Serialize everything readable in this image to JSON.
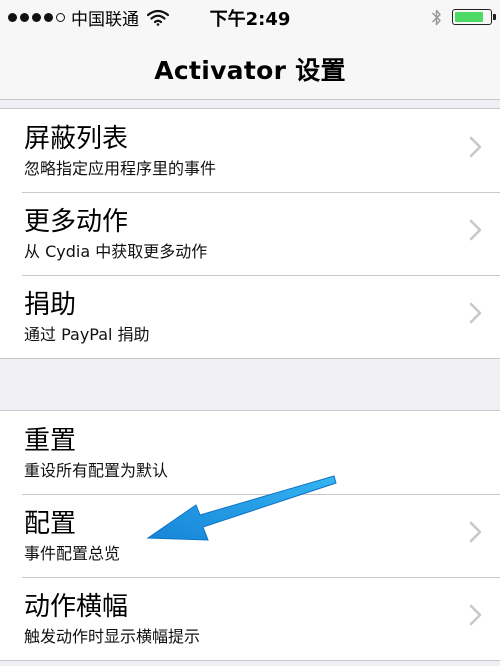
{
  "status_bar": {
    "carrier": "中国联通",
    "time": "下午2:49"
  },
  "nav": {
    "title": "Activator 设置"
  },
  "groups": [
    {
      "items": [
        {
          "title": "屏蔽列表",
          "subtitle": "忽略指定应用程序里的事件"
        },
        {
          "title": "更多动作",
          "subtitle": "从 Cydia 中获取更多动作"
        },
        {
          "title": "捐助",
          "subtitle": "通过 PayPal 捐助"
        }
      ]
    },
    {
      "items": [
        {
          "title": "重置",
          "subtitle": "重设所有配置为默认"
        },
        {
          "title": "配置",
          "subtitle": "事件配置总览"
        },
        {
          "title": "动作横幅",
          "subtitle": "触发动作时显示横幅提示"
        }
      ]
    }
  ],
  "icons": {
    "signal": "signal-dots-icon",
    "wifi": "wifi-icon",
    "bluetooth": "bluetooth-icon",
    "battery": "battery-icon",
    "chevron": "chevron-right-icon"
  },
  "battery_level": 0.85,
  "colors": {
    "battery": "#4cd964",
    "annotation_arrow": "#1a9be6",
    "separator": "#c8c7cc",
    "background": "#efeff4"
  }
}
